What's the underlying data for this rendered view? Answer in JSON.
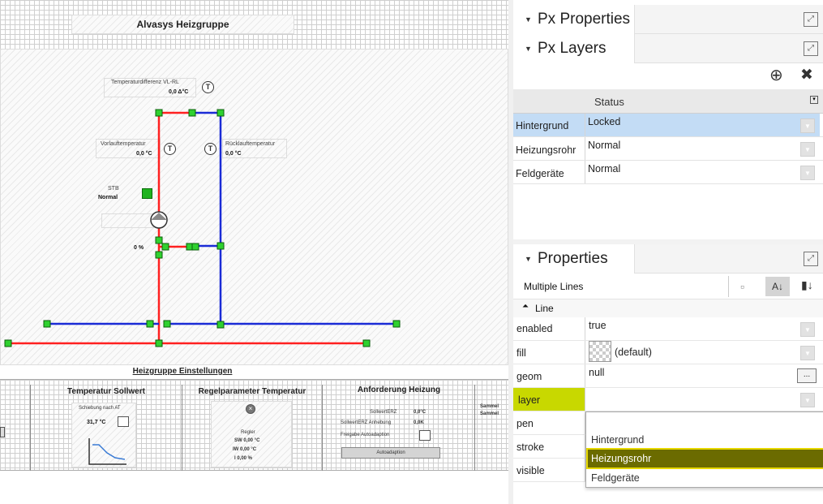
{
  "editor": {
    "title": "Alvasys Heizgruppe",
    "temp_diff_label": "Temperaturdifferenz VL-RL",
    "temp_diff_value": "0,0 Δ°C",
    "vorlauf_label": "Vorlauftemperatur",
    "vorlauf_value": "0,0 °C",
    "ruecklauf_label": "Rücklauftemperatur",
    "ruecklauf_value": "0,0 °C",
    "stb_label": "STB",
    "stb_value": "Normal",
    "pump_percent": "0 %",
    "sensor_symbol": "T",
    "settings_title": "Heizgruppe Einstellungen",
    "sections": {
      "sollwert": {
        "title": "Temperatur Sollwert",
        "schiebung_label": "Schiebung nach AT",
        "schiebung_value": "31,7 °C"
      },
      "regel": {
        "title": "Regelparameter Temperatur",
        "regler_label": "Regler",
        "sw": "SW 0,00 °C",
        "iw": "IW  0,00 °C",
        "i": "I    0,00 %"
      },
      "anforderung": {
        "title": "Anforderung Heizung",
        "sollwert_erz_label": "SollwertERZ",
        "sollwert_erz_value": "0,0°C",
        "anhebung_label": "SollwertERZ Anhebung",
        "anhebung_value": "0,0K",
        "freigabe_label": "Freigabe Autoadaption",
        "button": "Autoadaption"
      },
      "sammel": {
        "line1": "Sammel",
        "line2": "Sammel"
      }
    }
  },
  "panel": {
    "px_properties": {
      "title": "Px Properties"
    },
    "px_layers": {
      "title": "Px Layers",
      "add_icon": "⊕",
      "delete_icon": "✖",
      "column_header": "Status",
      "rows": [
        {
          "name": "Hintergrund",
          "status": "Locked"
        },
        {
          "name": "Heizungsrohr",
          "status": "Normal"
        },
        {
          "name": "Feldgeräte",
          "status": "Normal"
        }
      ]
    },
    "properties": {
      "title": "Properties",
      "selection": "Multiple Lines",
      "group": "Line",
      "rows": [
        {
          "name": "enabled",
          "value": "true"
        },
        {
          "name": "fill",
          "value": "(default)"
        },
        {
          "name": "geom",
          "value": "null"
        },
        {
          "name": "layer",
          "value": ""
        },
        {
          "name": "pen",
          "value": ""
        },
        {
          "name": "stroke",
          "value": ""
        },
        {
          "name": "visible",
          "value": ""
        }
      ],
      "geom_button": "...",
      "layer_options": [
        "Hintergrund",
        "Heizungsrohr",
        "Feldgeräte"
      ],
      "layer_highlighted": "Heizungsrohr"
    }
  },
  "colors": {
    "supply": "#ff2020",
    "return": "#1a2bd6",
    "node": "#2fd12f",
    "highlight": "#6b6b00",
    "layer_select": "#c8d800",
    "selected_row": "#c3dcf5"
  }
}
